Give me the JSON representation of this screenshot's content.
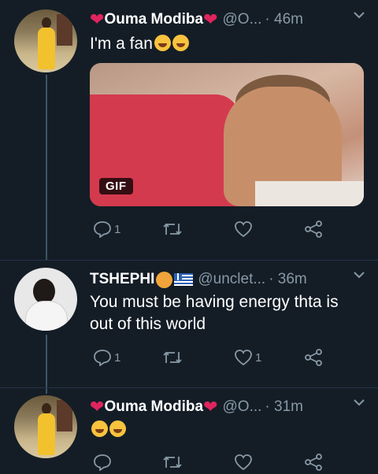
{
  "tweets": [
    {
      "name": "Ouma Modiba",
      "handle": "@O...",
      "time": "· 46m",
      "text": "I'm a fan",
      "media_badge": "GIF",
      "reply_count": "1",
      "retweet_count": "",
      "like_count": ""
    },
    {
      "name": "TSHEPHI",
      "handle": "@unclet...",
      "time": "· 36m",
      "text_line1": "You must be having energy thta is",
      "text_line2": "out of this world",
      "reply_count": "1",
      "retweet_count": "",
      "like_count": "1"
    },
    {
      "name": "Ouma Modiba",
      "handle": "@O...",
      "time": "· 31m",
      "text": "",
      "reply_count": "",
      "retweet_count": "",
      "like_count": ""
    }
  ],
  "colors": {
    "background": "#141d26",
    "secondary_text": "#8899a6",
    "heart": "#e0245e",
    "thread_line": "#3d5466"
  },
  "icons": [
    "reply-icon",
    "retweet-icon",
    "like-icon",
    "share-icon",
    "chevron-down-icon",
    "heart-emoji",
    "laughing-emoji",
    "lion-emoji",
    "greece-flag-emoji"
  ]
}
